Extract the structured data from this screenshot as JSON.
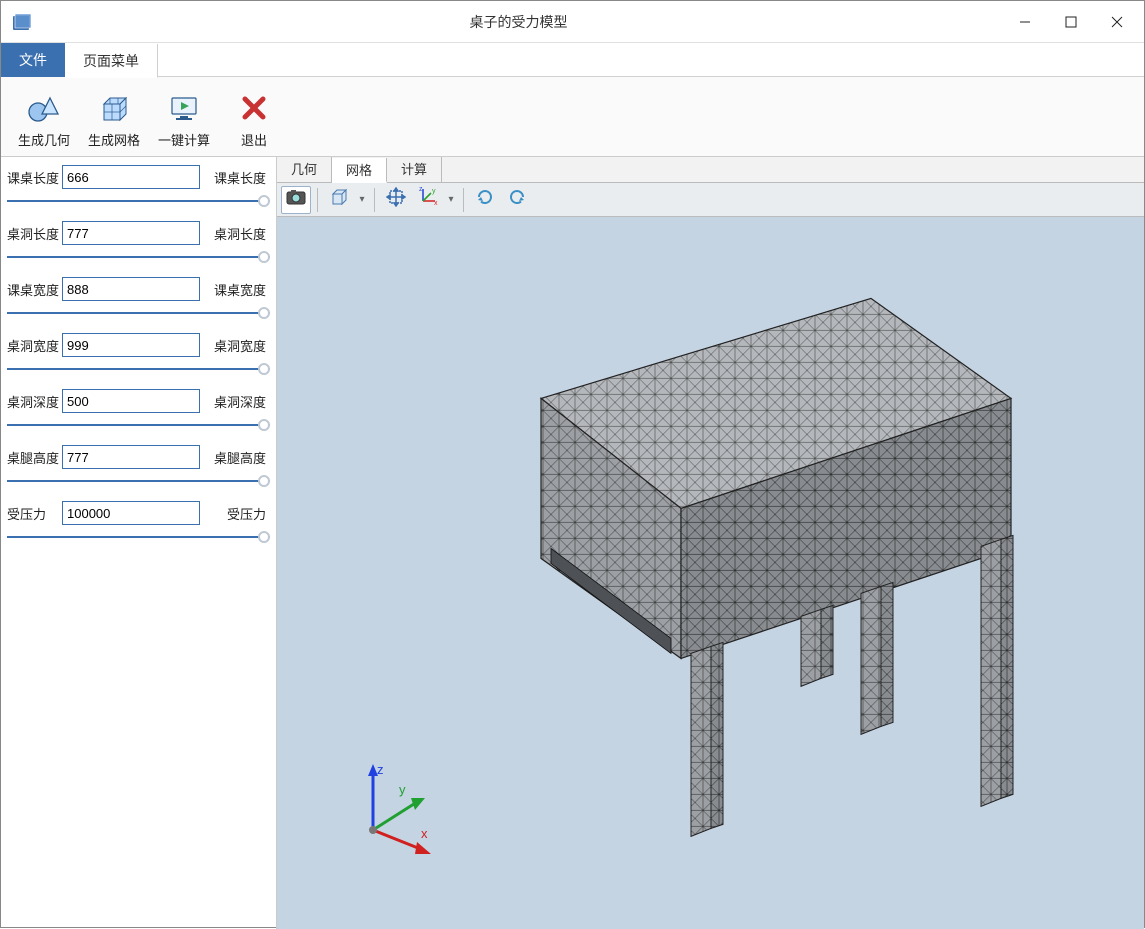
{
  "window": {
    "title": "桌子的受力模型"
  },
  "menubar": {
    "file": "文件",
    "page_menu": "页面菜单"
  },
  "ribbon": {
    "gen_geom": "生成几何",
    "gen_mesh": "生成网格",
    "one_click": "一键计算",
    "exit": "退出"
  },
  "sidebar": {
    "params": [
      {
        "label": "课桌长度",
        "value": "666",
        "right": "课桌长度"
      },
      {
        "label": "桌洞长度",
        "value": "777",
        "right": "桌洞长度"
      },
      {
        "label": "课桌宽度",
        "value": "888",
        "right": "课桌宽度"
      },
      {
        "label": "桌洞宽度",
        "value": "999",
        "right": "桌洞宽度"
      },
      {
        "label": "桌洞深度",
        "value": "500",
        "right": "桌洞深度"
      },
      {
        "label": "桌腿高度",
        "value": "777",
        "right": "桌腿高度"
      },
      {
        "label": "受压力",
        "value": "100000",
        "right": "受压力"
      }
    ]
  },
  "content_tabs": {
    "geom": "几何",
    "mesh": "网格",
    "calc": "计算"
  },
  "axes": {
    "x": "x",
    "y": "y",
    "z": "z"
  }
}
